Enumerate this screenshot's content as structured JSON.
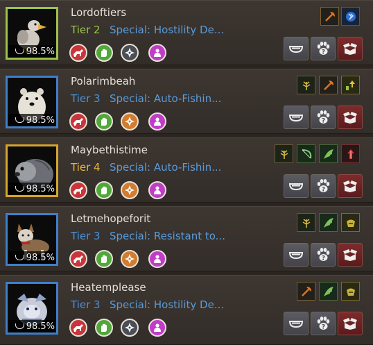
{
  "colors": {
    "tier_blue": "#4a90d9",
    "tier_green": "#9bc24a",
    "tier_yellow": "#e8b83a",
    "special_text": "#5a9ad6",
    "name_text": "#e4dfd8"
  },
  "pets": [
    {
      "name": "Lordoftiers",
      "tier": "Tier 2",
      "tier_color": "#9bc24a",
      "frame_color": "#9bc24a",
      "special": "Special: Hostility De...",
      "hunger": "98.5%",
      "portrait": "bird",
      "commands": [
        "red",
        "green",
        "gray",
        "purple"
      ],
      "skills": [
        "axe-skill-icon",
        "blue-spark-skill-icon"
      ]
    },
    {
      "name": "Polarimbeah",
      "tier": "Tier 3",
      "tier_color": "#4a90d9",
      "frame_color": "#3f7fc9",
      "special": "Special: Auto-Fishin...",
      "hunger": "98.5%",
      "portrait": "polar-bear",
      "commands": [
        "red",
        "green",
        "orange",
        "purple"
      ],
      "skills": [
        "plant-skill-icon",
        "axe-skill-icon",
        "gather-up-skill-icon"
      ]
    },
    {
      "name": "Maybethistime",
      "tier": "Tier 4",
      "tier_color": "#e8b83a",
      "frame_color": "#d6a52c",
      "special": "Special: Auto-Fishin...",
      "hunger": "98.5%",
      "portrait": "seal",
      "commands": [
        "red",
        "green",
        "orange",
        "purple"
      ],
      "skills": [
        "plant-skill-icon",
        "bow-skill-icon",
        "wing-skill-icon",
        "red-arrow-skill-icon"
      ]
    },
    {
      "name": "Letmehopeforit",
      "tier": "Tier 3",
      "tier_color": "#4a90d9",
      "frame_color": "#3f7fc9",
      "special": "Special: Resistant to...",
      "hunger": "98.5%",
      "portrait": "fox-dog",
      "commands": [
        "red",
        "green",
        "orange",
        "purple"
      ],
      "skills": [
        "plant-skill-icon",
        "wing-skill-icon",
        "loot-skill-icon"
      ]
    },
    {
      "name": "Heatemplease",
      "tier": "Tier 3",
      "tier_color": "#4a90d9",
      "frame_color": "#3f7fc9",
      "special": "Special: Hostility De...",
      "hunger": "98.5%",
      "portrait": "armored-dog",
      "commands": [
        "red",
        "green",
        "gray",
        "purple"
      ],
      "skills": [
        "axe-skill-icon",
        "wing-skill-icon",
        "loot-skill-icon"
      ]
    }
  ]
}
